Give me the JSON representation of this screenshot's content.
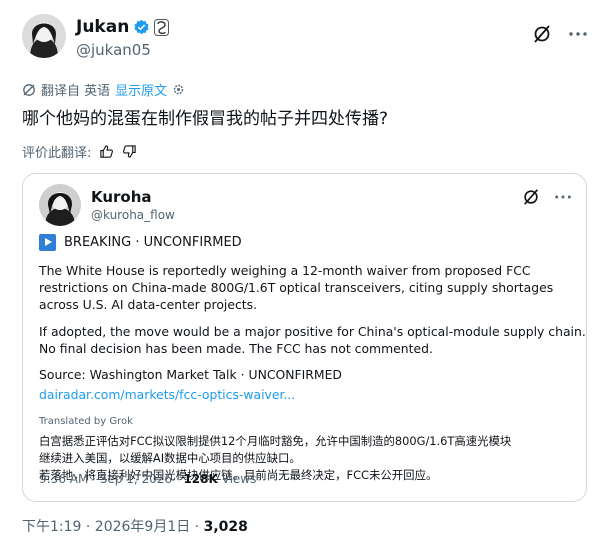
{
  "author": {
    "name": "Jukan",
    "handle": "@jukan05",
    "verified_color": "#1d9bf0"
  },
  "translation": {
    "from_label": "翻译自 英语",
    "show_original": "显示原文"
  },
  "tweet_text": "哪个他妈的混蛋在制作假冒我的帖子并四处传播?",
  "rate_translation": "评价此翻译:",
  "quote": {
    "name": "Kuroha",
    "handle": "@kuroha_flow",
    "breaking": "BREAKING · UNCONFIRMED",
    "para1": [
      "The White House is reportedly weighing a 12-month waiver from proposed FCC",
      "restrictions on China-made 800G/1.6T optical transceivers, citing supply shortages",
      "across U.S. AI data-center projects."
    ],
    "para2": [
      "If adopted, the move would be a major positive for China's optical-module supply chain.",
      "No final decision has been made. The FCC has not commented."
    ],
    "source": "Source: Washington Market Talk · UNCONFIRMED",
    "link": "dairadar.com/markets/fcc-optics-waiver...",
    "translated_by": "Translated by Grok",
    "zh": [
      "白宫据悉正评估对FCC拟议限制提供12个月临时豁免，允许中国制造的800G/1.6T高速光模块",
      "继续进入美国，以缓解AI数据中心项目的供应缺口。",
      "若落地，将直接利好中国光模块供应链。目前尚无最终决定，FCC未公开回应。"
    ],
    "time": "9:36 AM · Sep 1, 2026 · ",
    "views_count": "128K",
    "views_label": " Views"
  },
  "footer": {
    "time": "下午1:19 · 2026年9月1日 · ",
    "views": "3,028"
  },
  "icons": {
    "grok": "grok-slash-icon",
    "more": "more-dots-icon",
    "translate": "translate-icon",
    "thumb_up": "thumb-up-icon",
    "thumb_down": "thumb-down-icon"
  }
}
